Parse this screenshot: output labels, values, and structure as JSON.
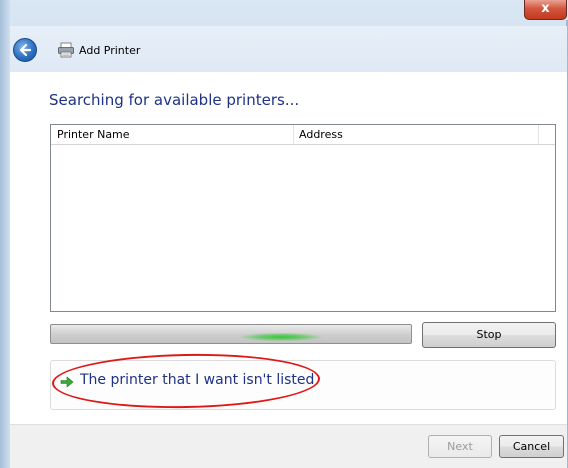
{
  "window": {
    "title": "Add Printer",
    "close_label": "x"
  },
  "icons": {
    "back": "back-arrow-icon",
    "printer": "printer-icon",
    "link_arrow": "green-arrow-icon"
  },
  "main": {
    "heading": "Searching for available printers...",
    "list": {
      "columns": [
        "Printer Name",
        "Address"
      ],
      "rows": []
    },
    "stop_label": "Stop",
    "not_listed_link": "The printer that I want isn't listed"
  },
  "footer": {
    "next_label": "Next",
    "cancel_label": "Cancel"
  },
  "colors": {
    "heading": "#1e3287",
    "annotation": "#e01818",
    "progress_glow": "#37c837"
  }
}
